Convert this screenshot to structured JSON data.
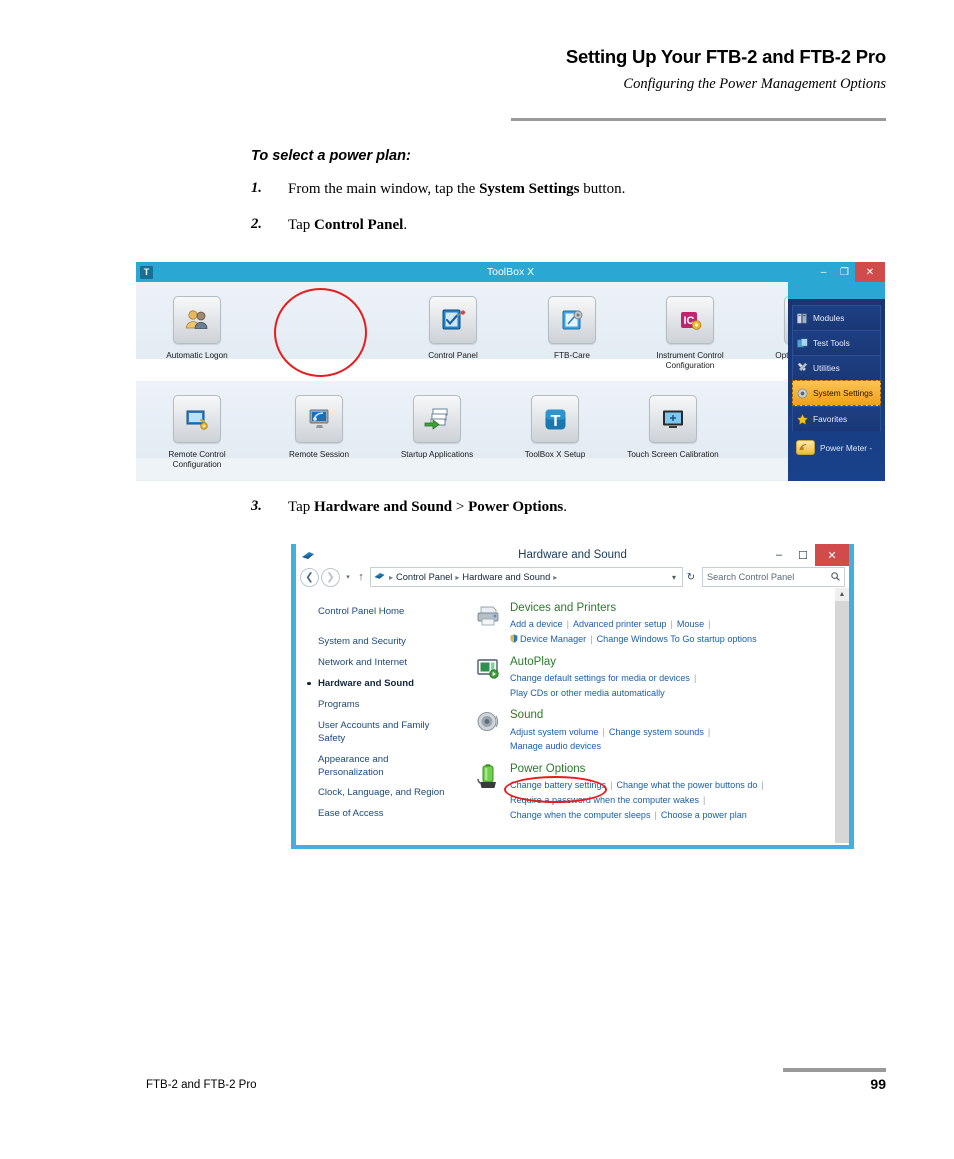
{
  "header": {
    "title": "Setting Up Your FTB-2 and FTB-2 Pro",
    "subtitle": "Configuring the Power Management Options"
  },
  "procedure": {
    "heading": "To select a power plan:",
    "steps": [
      {
        "num": "1.",
        "html": "From the main window, tap the <b>System Settings</b> button."
      },
      {
        "num": "2.",
        "html": "Tap <b>Control Panel</b>."
      },
      {
        "num": "3.",
        "html": "Tap <b>Hardware and Sound</b> &gt; <b>Power Options</b>."
      }
    ]
  },
  "toolbox_window": {
    "title": "ToolBox X",
    "app_icon_letter": "T",
    "window_buttons": {
      "minimize": "–",
      "restore": "❐",
      "close": "✕"
    },
    "icons": [
      {
        "label": "Automatic Logon",
        "icon": "users-icon"
      },
      {
        "label": "Control Panel",
        "icon": "control-panel-icon",
        "highlighted": true
      },
      {
        "label": "FTB-Care",
        "icon": "ftb-care-icon"
      },
      {
        "label": "Instrument Control\nConfiguration",
        "icon": "instrument-control-icon"
      },
      {
        "label": "Options Activation",
        "icon": "options-activation-icon"
      },
      {
        "label": "Remote Control\nConfiguration",
        "icon": "remote-control-icon"
      },
      {
        "label": "Remote Session",
        "icon": "remote-session-icon"
      },
      {
        "label": "Startup Applications",
        "icon": "startup-applications-icon"
      },
      {
        "label": "ToolBox X Setup",
        "icon": "toolbox-setup-icon"
      },
      {
        "label": "Touch Screen Calibration",
        "icon": "touch-calibration-icon"
      }
    ],
    "sidebar": {
      "items": [
        {
          "label": "Modules",
          "icon": "modules-icon",
          "active": false
        },
        {
          "label": "Test Tools",
          "icon": "test-tools-icon",
          "active": false
        },
        {
          "label": "Utilities",
          "icon": "utilities-icon",
          "active": false
        },
        {
          "label": "System Settings",
          "icon": "system-settings-icon",
          "active": true
        },
        {
          "label": "Favorites",
          "icon": "star-icon",
          "active": false
        }
      ],
      "power_meter": {
        "label": "Power Meter -",
        "icon": "power-meter-icon"
      }
    },
    "colors": {
      "titlebar": "#2ba7d4",
      "sidebar": "#1b3a7a",
      "active_item": "#f0a01e",
      "close": "#d24b4b"
    }
  },
  "control_panel_window": {
    "title": "Hardware and Sound",
    "window_buttons": {
      "minimize": "–",
      "maximize": "☐",
      "close": "✕"
    },
    "address_bar": {
      "back": "❮",
      "forward": "❯",
      "recent_caret": "▾",
      "up": "↑",
      "breadcrumbs": [
        "Control Panel",
        "Hardware and Sound"
      ],
      "separator": "▸",
      "dropdown": "▾",
      "refresh": "↻",
      "search_placeholder": "Search Control Panel",
      "search_icon": "🔍"
    },
    "nav": {
      "home": "Control Panel Home",
      "items": [
        {
          "label": "System and Security",
          "current": false
        },
        {
          "label": "Network and Internet",
          "current": false
        },
        {
          "label": "Hardware and Sound",
          "current": true
        },
        {
          "label": "Programs",
          "current": false
        },
        {
          "label": "User Accounts and Family Safety",
          "current": false
        },
        {
          "label": "Appearance and Personalization",
          "current": false
        },
        {
          "label": "Clock, Language, and Region",
          "current": false
        },
        {
          "label": "Ease of Access",
          "current": false
        }
      ]
    },
    "sections": [
      {
        "title": "Devices and Printers",
        "icon": "printer-icon",
        "link_rows": [
          [
            {
              "text": "Add a device"
            },
            {
              "text": "Advanced printer setup"
            },
            {
              "text": "Mouse"
            },
            {
              "text": ""
            }
          ],
          [
            {
              "text": "Device Manager",
              "shield": true
            },
            {
              "text": "Change Windows To Go startup options"
            }
          ]
        ]
      },
      {
        "title": "AutoPlay",
        "icon": "autoplay-icon",
        "link_rows": [
          [
            {
              "text": "Change default settings for media or devices"
            },
            {
              "text": ""
            }
          ],
          [
            {
              "text": "Play CDs or other media automatically"
            }
          ]
        ]
      },
      {
        "title": "Sound",
        "icon": "sound-icon",
        "link_rows": [
          [
            {
              "text": "Adjust system volume"
            },
            {
              "text": "Change system sounds"
            },
            {
              "text": ""
            }
          ],
          [
            {
              "text": "Manage audio devices"
            }
          ]
        ]
      },
      {
        "title": "Power Options",
        "icon": "power-options-icon",
        "highlighted": true,
        "link_rows": [
          [
            {
              "text": "Change battery settings"
            },
            {
              "text": "Change what the power buttons do"
            },
            {
              "text": ""
            }
          ],
          [
            {
              "text": "Require a password when the computer wakes"
            },
            {
              "text": ""
            }
          ],
          [
            {
              "text": "Change when the computer sleeps"
            },
            {
              "text": "Choose a power plan"
            }
          ]
        ]
      }
    ],
    "scrollbar": {
      "up_arrow": "▲"
    },
    "colors": {
      "border": "#41b0dd",
      "section_title": "#2b7a2b",
      "link": "#1c5fa8",
      "close": "#d24b4b"
    }
  },
  "footer": {
    "left": "FTB-2 and FTB-2 Pro",
    "page_number": "99"
  },
  "annotation_color": "#e81c1c"
}
